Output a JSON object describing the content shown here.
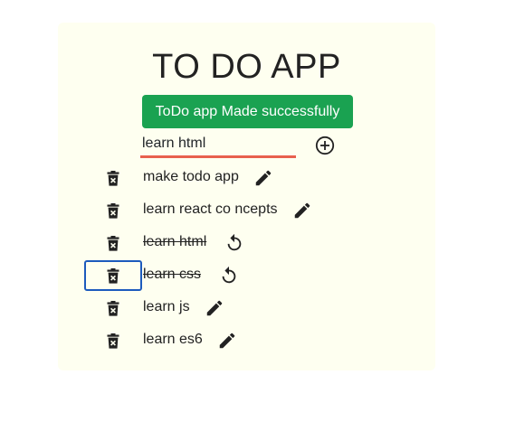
{
  "app": {
    "title": "TO DO APP"
  },
  "toast": {
    "message": "ToDo app Made successfully"
  },
  "input": {
    "value": "learn html"
  },
  "todos": [
    {
      "text": "make todo app",
      "done": false,
      "action": "edit-icon"
    },
    {
      "text": "learn react co ncepts",
      "done": false,
      "action": "edit-icon"
    },
    {
      "text": "learn html",
      "done": true,
      "action": "undo-icon"
    },
    {
      "text": "learn css",
      "done": true,
      "action": "undo-icon",
      "focused": true
    },
    {
      "text": "learn js",
      "done": false,
      "action": "edit-icon"
    },
    {
      "text": "learn es6",
      "done": false,
      "action": "edit-icon"
    }
  ],
  "colors": {
    "card_bg": "#fefff0",
    "toast_bg": "#1aa251",
    "input_underline": "#e8604e",
    "focus_ring": "#1d5bbd"
  }
}
